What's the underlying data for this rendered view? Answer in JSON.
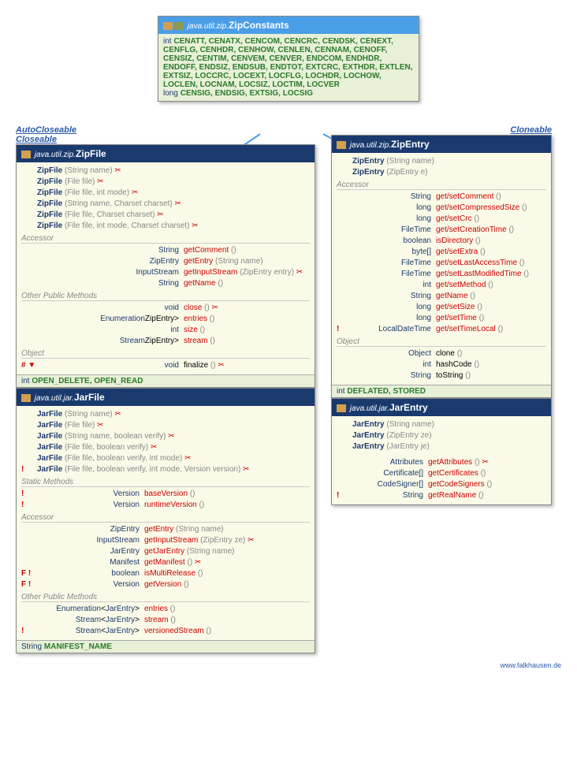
{
  "zipconst": {
    "pkg": "java.util.zip.",
    "name": "ZipConstants",
    "intLine": "int",
    "ints": "CENATT, CENATX, CENCOM, CENCRC, CENDSK, CENEXT, CENFLG, CENHDR, CENHOW, CENLEN, CENNAM, CENOFF, CENSIZ, CENTIM, CENVEM, CENVER, ENDCOM, ENDHDR, ENDOFF, ENDSIZ, ENDSUB, ENDTOT, EXTCRC, EXTHDR, EXTLEN, EXTSIZ, LOCCRC, LOCEXT, LOCFLG, LOCHDR, LOCHOW, LOCLEN, LOCNAM, LOCSIZ, LOCTIM, LOCVER",
    "longLine": "long",
    "longs": "CENSIG, ENDSIG, EXTSIG, LOCSIG"
  },
  "labels": {
    "auto": "AutoCloseable",
    "close": "Closeable",
    "clone": "Cloneable"
  },
  "zipfile": {
    "pkg": "java.util.zip.",
    "name": "ZipFile",
    "ctors": [
      {
        "sig": "(String name)",
        "x": "✂"
      },
      {
        "sig": "(File file)",
        "x": "✂"
      },
      {
        "sig": "(File file, int mode)",
        "x": "✂"
      },
      {
        "sig": "(String name, Charset charset)",
        "x": "✂"
      },
      {
        "sig": "(File file, Charset charset)",
        "x": "✂"
      },
      {
        "sig": "(File file, int mode, Charset charset)",
        "x": "✂"
      }
    ],
    "acc": [
      {
        "ret": "String",
        "m": "getComment",
        "p": "()"
      },
      {
        "ret": "ZipEntry",
        "m": "getEntry",
        "p": "(String name)"
      },
      {
        "ret": "InputStream",
        "m": "getInputStream",
        "p": "(ZipEntry entry)",
        "x": "✂"
      },
      {
        "ret": "String",
        "m": "getName",
        "p": "()"
      }
    ],
    "pub": [
      {
        "ret": "void",
        "m": "close",
        "p": "()",
        "x": "✂"
      },
      {
        "ret": "Enumeration<? extends ZipEntry>",
        "m": "entries",
        "p": "()"
      },
      {
        "ret": "int",
        "m": "size",
        "p": "()"
      },
      {
        "ret": "Stream<? extends ZipEntry>",
        "m": "stream",
        "p": "()"
      }
    ],
    "obj": [
      {
        "mark": "# ▼",
        "ret": "void",
        "m": "finalize",
        "p": "()",
        "x": "✂"
      }
    ],
    "consts": "OPEN_DELETE, OPEN_READ",
    "ctype": "int"
  },
  "jarfile": {
    "pkg": "java.util.jar.",
    "name": "JarFile",
    "ctors": [
      {
        "mark": "",
        "sig": "(String name)",
        "x": "✂"
      },
      {
        "mark": "",
        "sig": "(File file)",
        "x": "✂"
      },
      {
        "mark": "",
        "sig": "(String name, boolean verify)",
        "x": "✂"
      },
      {
        "mark": "",
        "sig": "(File file, boolean verify)",
        "x": "✂"
      },
      {
        "mark": "",
        "sig": "(File file, boolean verify, int mode)",
        "x": "✂"
      },
      {
        "mark": "!",
        "sig": "(File file, boolean verify, int mode, Version version)",
        "x": "✂"
      }
    ],
    "static": [
      {
        "mark": "!",
        "ret": "Version",
        "m": "baseVersion",
        "p": "()"
      },
      {
        "mark": "!",
        "ret": "Version",
        "m": "runtimeVersion",
        "p": "()"
      }
    ],
    "acc": [
      {
        "mark": "",
        "ret": "ZipEntry",
        "m": "getEntry",
        "p": "(String name)"
      },
      {
        "mark": "",
        "ret": "InputStream",
        "m": "getInputStream",
        "p": "(ZipEntry ze)",
        "x": "✂"
      },
      {
        "mark": "",
        "ret": "JarEntry",
        "m": "getJarEntry",
        "p": "(String name)"
      },
      {
        "mark": "",
        "ret": "Manifest",
        "m": "getManifest",
        "p": "()",
        "x": "✂"
      },
      {
        "mark": "F !",
        "ret": "boolean",
        "m": "isMultiRelease",
        "p": "()"
      },
      {
        "mark": "F !",
        "ret": "Version",
        "m": "getVersion",
        "p": "()"
      }
    ],
    "pub": [
      {
        "mark": "",
        "ret": "Enumeration<JarEntry>",
        "m": "entries",
        "p": "()"
      },
      {
        "mark": "",
        "ret": "Stream<JarEntry>",
        "m": "stream",
        "p": "()"
      },
      {
        "mark": "!",
        "ret": "Stream<JarEntry>",
        "m": "versionedStream",
        "p": "()"
      }
    ],
    "consts": "MANIFEST_NAME",
    "ctype": "String"
  },
  "zipentry": {
    "pkg": "java.util.zip.",
    "name": "ZipEntry",
    "ctors": [
      {
        "sig": "(String name)"
      },
      {
        "sig": "(ZipEntry e)"
      }
    ],
    "acc": [
      {
        "mark": "",
        "ret": "String",
        "m": "get/setComment",
        "p": "()"
      },
      {
        "mark": "",
        "ret": "long",
        "m": "get/setCompressedSize",
        "p": "()"
      },
      {
        "mark": "",
        "ret": "long",
        "m": "get/setCrc",
        "p": "()"
      },
      {
        "mark": "",
        "ret": "FileTime",
        "m": "get/setCreationTime",
        "p": "()"
      },
      {
        "mark": "",
        "ret": "boolean",
        "m": "isDirectory",
        "p": "()"
      },
      {
        "mark": "",
        "ret": "byte[]",
        "m": "get/setExtra",
        "p": "()"
      },
      {
        "mark": "",
        "ret": "FileTime",
        "m": "get/setLastAccessTime",
        "p": "()"
      },
      {
        "mark": "",
        "ret": "FileTime",
        "m": "get/setLastModifiedTime",
        "p": "()"
      },
      {
        "mark": "",
        "ret": "int",
        "m": "get/setMethod",
        "p": "()"
      },
      {
        "mark": "",
        "ret": "String",
        "m": "getName",
        "p": "()"
      },
      {
        "mark": "",
        "ret": "long",
        "m": "get/setSize",
        "p": "()"
      },
      {
        "mark": "",
        "ret": "long",
        "m": "get/setTime",
        "p": "()"
      },
      {
        "mark": "!",
        "ret": "LocalDateTime",
        "m": "get/setTimeLocal",
        "p": "()"
      }
    ],
    "obj": [
      {
        "ret": "Object",
        "m": "clone",
        "p": "()"
      },
      {
        "ret": "int",
        "m": "hashCode",
        "p": "()"
      },
      {
        "ret": "String",
        "m": "toString",
        "p": "()"
      }
    ],
    "consts": "DEFLATED, STORED",
    "ctype": "int"
  },
  "jarentry": {
    "pkg": "java.util.jar.",
    "name": "JarEntry",
    "ctors": [
      {
        "sig": "(String name)"
      },
      {
        "sig": "(ZipEntry ze)"
      },
      {
        "sig": "(JarEntry je)"
      }
    ],
    "acc": [
      {
        "mark": "",
        "ret": "Attributes",
        "m": "getAttributes",
        "p": "()",
        "x": "✂"
      },
      {
        "mark": "",
        "ret": "Certificate[]",
        "m": "getCertificates",
        "p": "()"
      },
      {
        "mark": "",
        "ret": "CodeSigner[]",
        "m": "getCodeSigners",
        "p": "()"
      },
      {
        "mark": "!",
        "ret": "String",
        "m": "getRealName",
        "p": "()"
      }
    ]
  },
  "sects": {
    "acc": "Accessor",
    "pub": "Other Public Methods",
    "obj": "Object",
    "stat": "Static Methods"
  },
  "attrib": "www.falkhausen.de"
}
